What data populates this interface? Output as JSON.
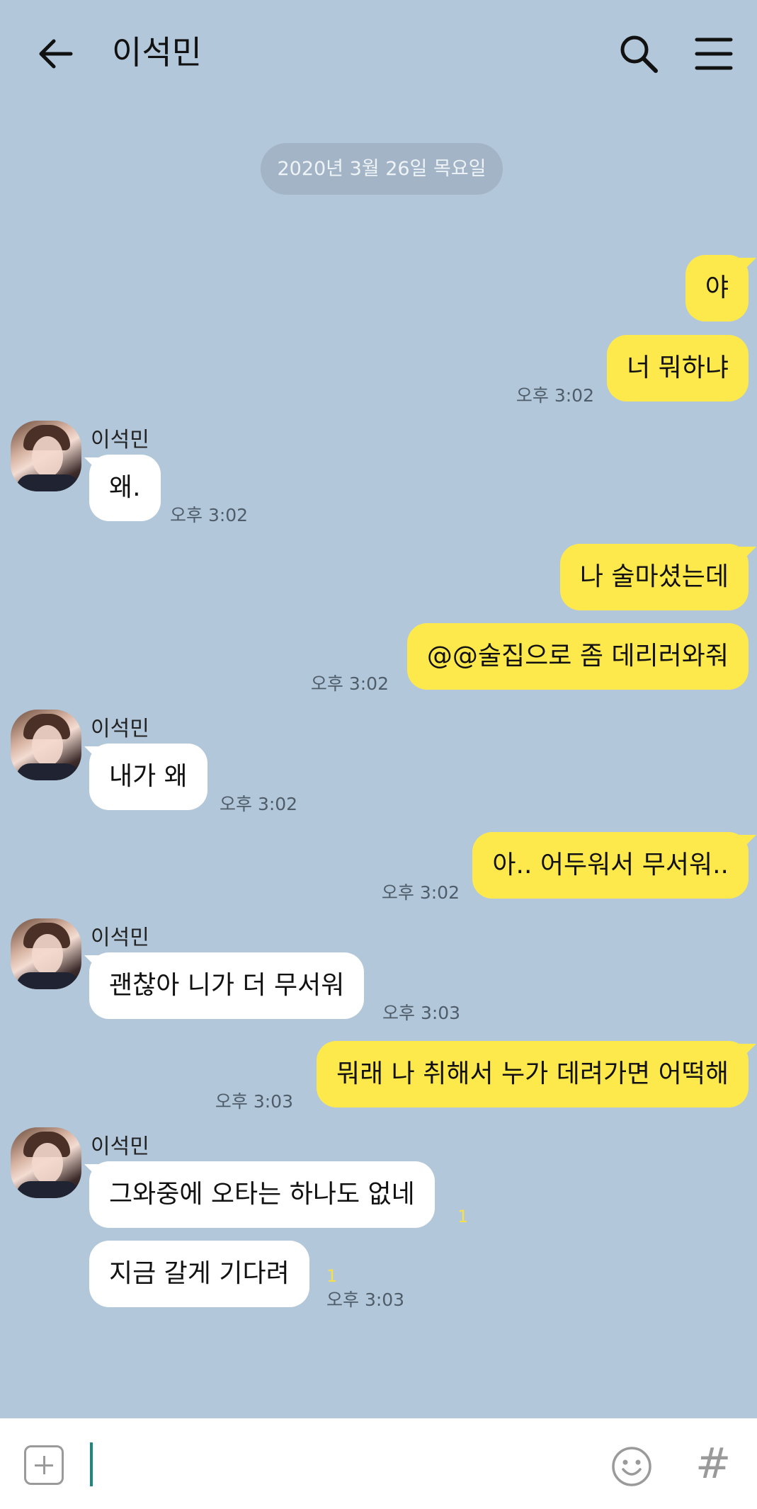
{
  "header": {
    "title": "이석민"
  },
  "date_divider": "2020년 3월 26일 목요일",
  "messages": [
    {
      "id": "m1",
      "side": "me",
      "text": "야"
    },
    {
      "id": "m2",
      "side": "me",
      "text": "너 뭐하냐",
      "time": "오후 3:02"
    },
    {
      "id": "m3",
      "side": "them",
      "sender": "이석민",
      "text": "왜.",
      "time": "오후 3:02"
    },
    {
      "id": "m4",
      "side": "me",
      "text": "나 술마셨는데"
    },
    {
      "id": "m5",
      "side": "me",
      "text": "@@술집으로 좀 데리러와줘",
      "time": "오후 3:02"
    },
    {
      "id": "m6",
      "side": "them",
      "sender": "이석민",
      "text": "내가 왜",
      "time": "오후 3:02"
    },
    {
      "id": "m7",
      "side": "me",
      "text": "아.. 어두워서 무서워..",
      "time": "오후 3:02"
    },
    {
      "id": "m8",
      "side": "them",
      "sender": "이석민",
      "text": "괜찮아 니가 더 무서워",
      "time": "오후 3:03"
    },
    {
      "id": "m9",
      "side": "me",
      "text": "뭐래 나 취해서 누가 데려가면 어떡해",
      "time": "오후 3:03"
    },
    {
      "id": "m10",
      "side": "them",
      "sender": "이석민",
      "text": "그와중에 오타는 하나도 없네",
      "unread": "1"
    },
    {
      "id": "m11",
      "side": "them",
      "text": "지금 갈게 기다려",
      "unread": "1",
      "time": "오후 3:03"
    }
  ],
  "composer": {
    "value": "",
    "hash_label": "#"
  },
  "icons": [
    "back-arrow-icon",
    "search-icon",
    "menu-icon",
    "plus-icon",
    "emoji-icon",
    "hash-icon"
  ],
  "colors": {
    "background": "#b2c7da",
    "my_bubble": "#fee94d",
    "their_bubble": "#ffffff",
    "unread": "#f5e04a"
  }
}
